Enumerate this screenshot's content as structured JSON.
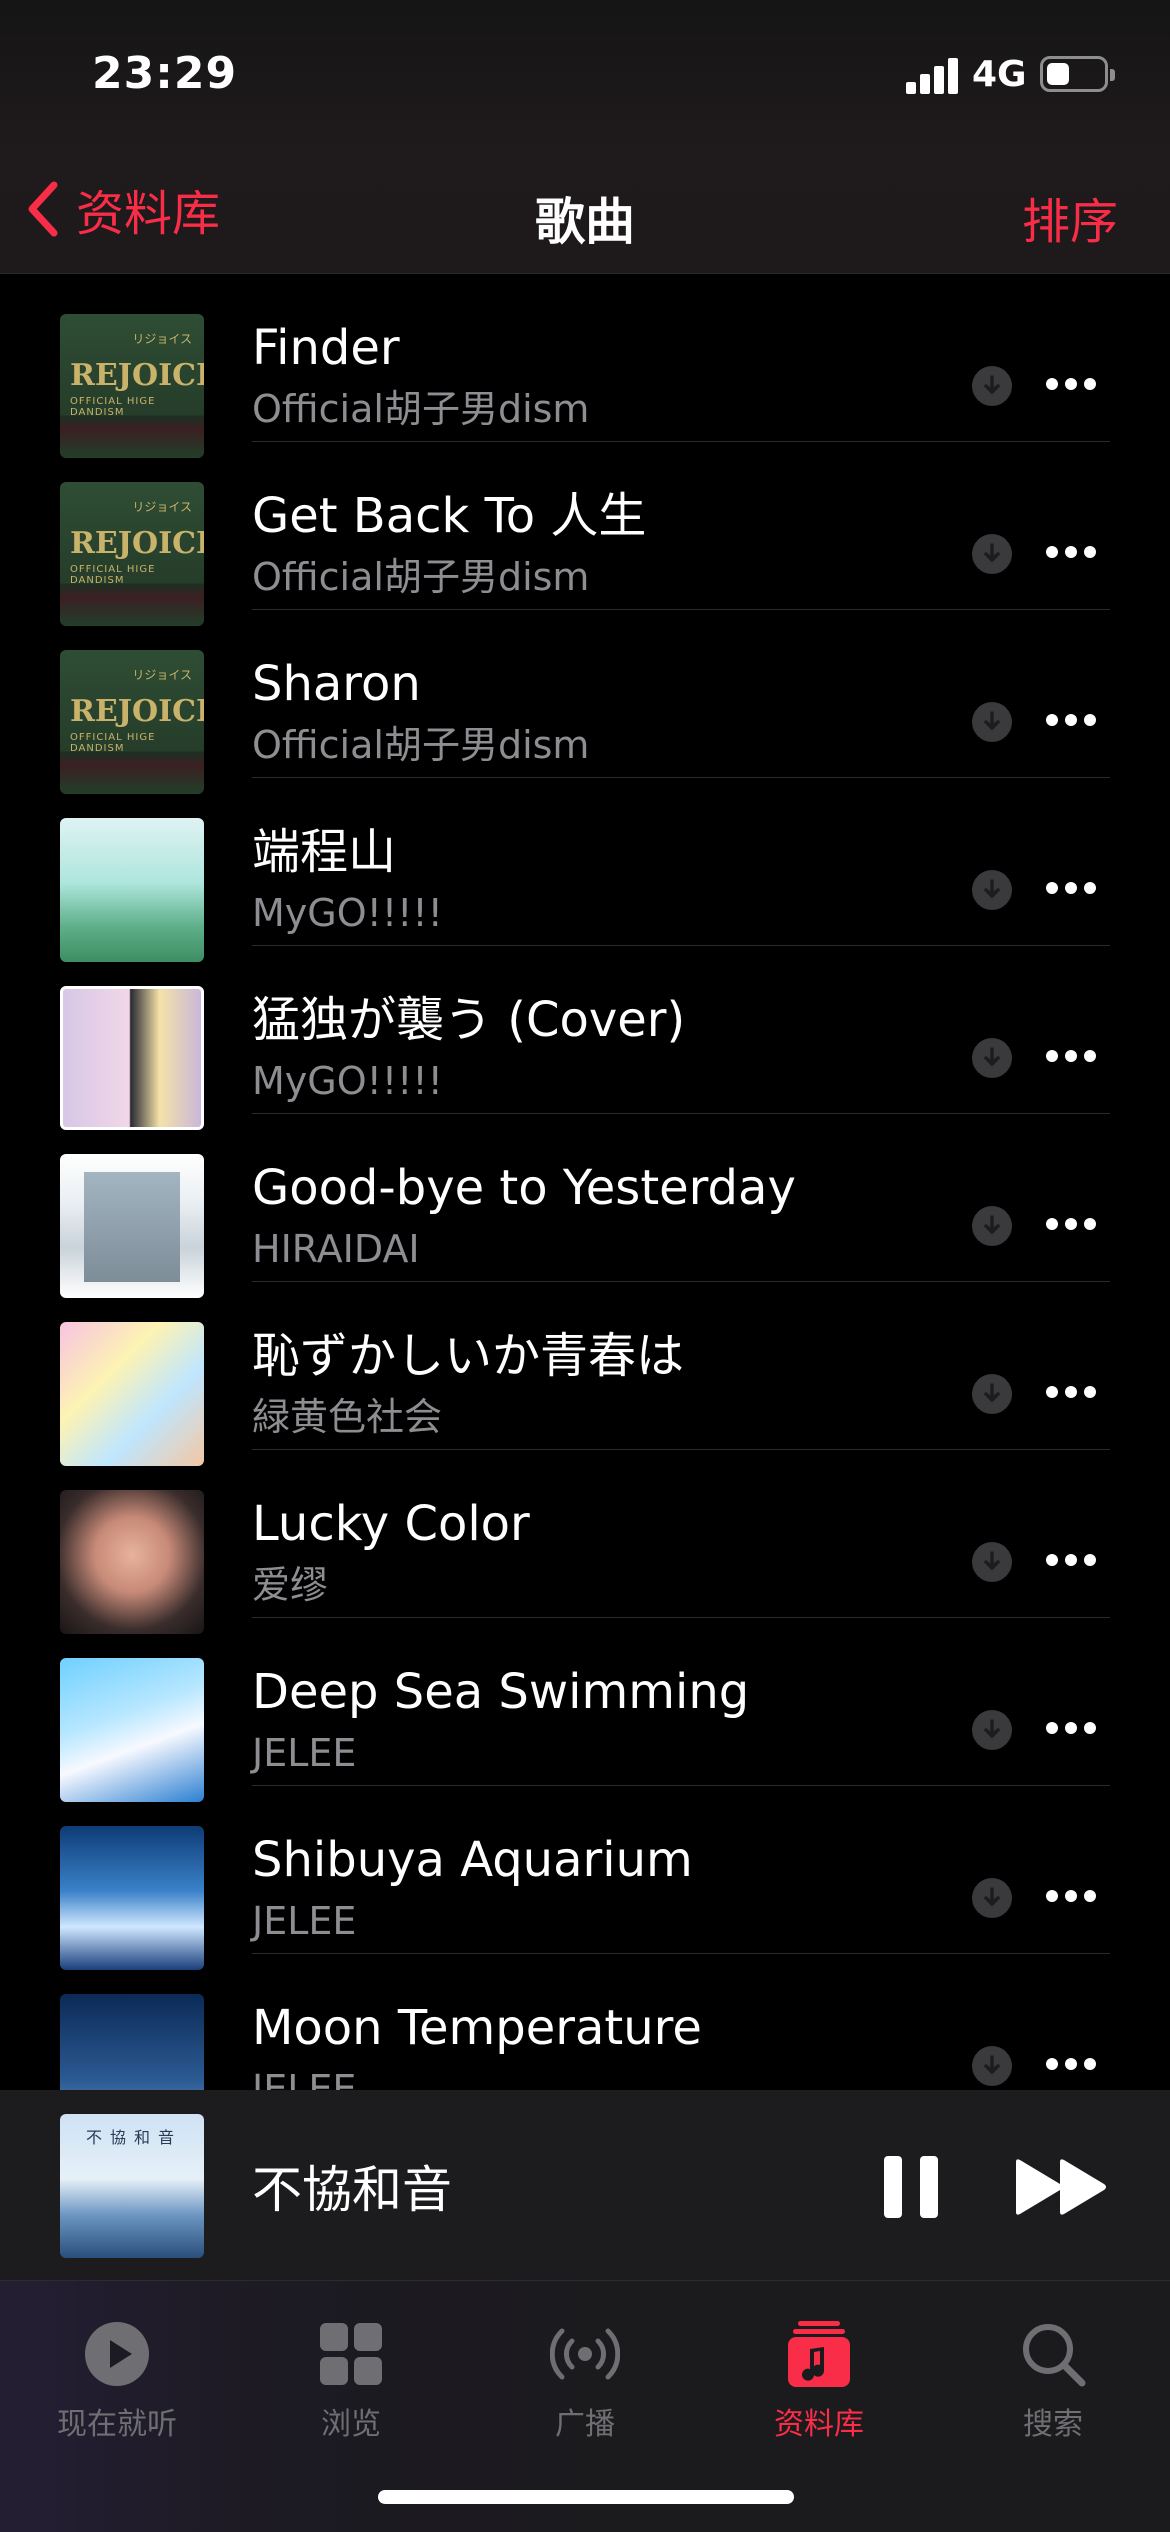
{
  "status_bar": {
    "time": "23:29",
    "network": "4G"
  },
  "nav": {
    "back_label": "资料库",
    "title": "歌曲",
    "sort_label": "排序"
  },
  "songs": [
    {
      "title": "Finder",
      "artist": "Official胡子男dism"
    },
    {
      "title": "Get Back To 人生",
      "artist": "Official胡子男dism"
    },
    {
      "title": "Sharon",
      "artist": "Official胡子男dism"
    },
    {
      "title": "端程山",
      "artist": "MyGO!!!!!"
    },
    {
      "title": "猛独が襲う (Cover)",
      "artist": "MyGO!!!!!"
    },
    {
      "title": "Good-bye to Yesterday",
      "artist": "HIRAIDAI"
    },
    {
      "title": "恥ずかしいか青春は",
      "artist": "緑黄色社会"
    },
    {
      "title": "Lucky Color",
      "artist": "爱缪"
    },
    {
      "title": "Deep Sea Swimming",
      "artist": "JELEE"
    },
    {
      "title": "Shibuya Aquarium",
      "artist": "JELEE"
    },
    {
      "title": "Moon Temperature",
      "artist": "JELEE"
    }
  ],
  "album_art_text": {
    "rejoice": "REJOICE",
    "rejoice_sub": "OFFICIAL HIGE DANDISM",
    "rejoice_kana": "リジョイス",
    "kyowa": "不協和音"
  },
  "now_playing": {
    "title": "不協和音"
  },
  "tabs": [
    {
      "label": "现在就听",
      "icon": "play-circle-icon"
    },
    {
      "label": "浏览",
      "icon": "grid-icon"
    },
    {
      "label": "广播",
      "icon": "radio-icon"
    },
    {
      "label": "资料库",
      "icon": "music-library-icon",
      "active": true
    },
    {
      "label": "搜索",
      "icon": "search-icon"
    }
  ],
  "colors": {
    "accent": "#fa2d48",
    "secondary_text": "#8d8d92",
    "background": "#000000"
  }
}
